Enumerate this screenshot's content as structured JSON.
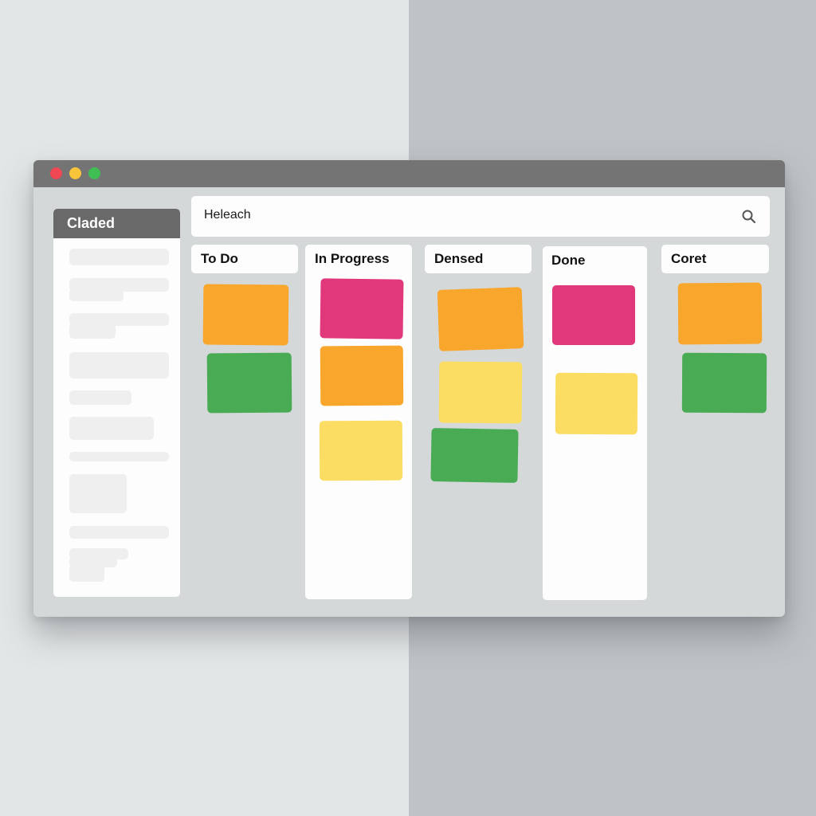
{
  "window": {
    "controls": [
      {
        "name": "close",
        "color": "#ef4754"
      },
      {
        "name": "minimize",
        "color": "#f8c53a"
      },
      {
        "name": "maximize",
        "color": "#3fbf53"
      }
    ]
  },
  "sidebar": {
    "title": "Claded",
    "placeholder_rows": 10
  },
  "search": {
    "value": "Heleach",
    "icon": "search-icon"
  },
  "colors": {
    "orange": "#f9a62c",
    "green": "#49ac55",
    "pink": "#e1387c",
    "yellow": "#fcdd63"
  },
  "board": {
    "columns": [
      {
        "title": "To Do",
        "cards": [
          "orange",
          "green"
        ]
      },
      {
        "title": "In Progress",
        "cards": [
          "pink",
          "orange",
          "yellow"
        ]
      },
      {
        "title": "Densed",
        "cards": [
          "orange",
          "yellow",
          "green"
        ]
      },
      {
        "title": "Done",
        "cards": [
          "pink",
          "yellow"
        ]
      },
      {
        "title": "Coret",
        "cards": [
          "orange",
          "green"
        ]
      }
    ]
  }
}
